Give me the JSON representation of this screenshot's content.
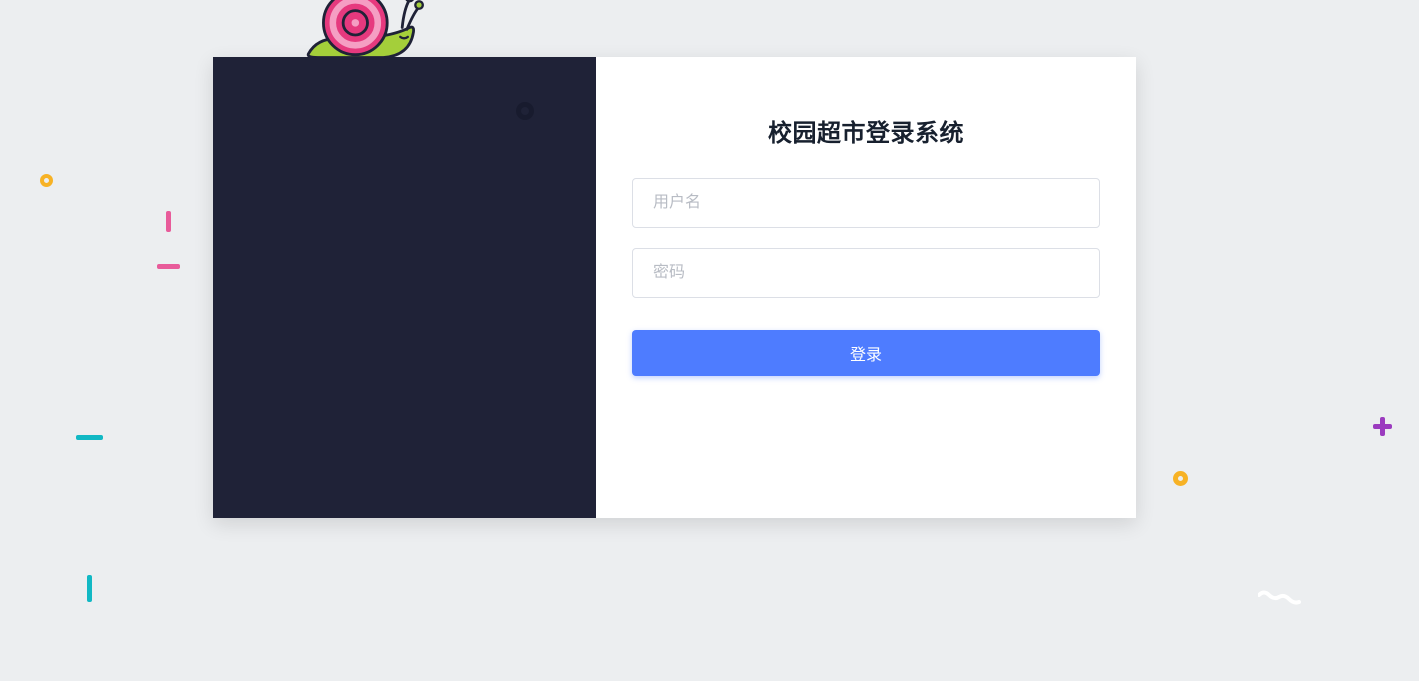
{
  "login": {
    "title": "校园超市登录系统",
    "username_placeholder": "用户名",
    "password_placeholder": "密码",
    "button_label": "登录"
  },
  "colors": {
    "accent": "#4e7cff",
    "dark_panel": "#1f2237",
    "bg": "#eceef0"
  }
}
